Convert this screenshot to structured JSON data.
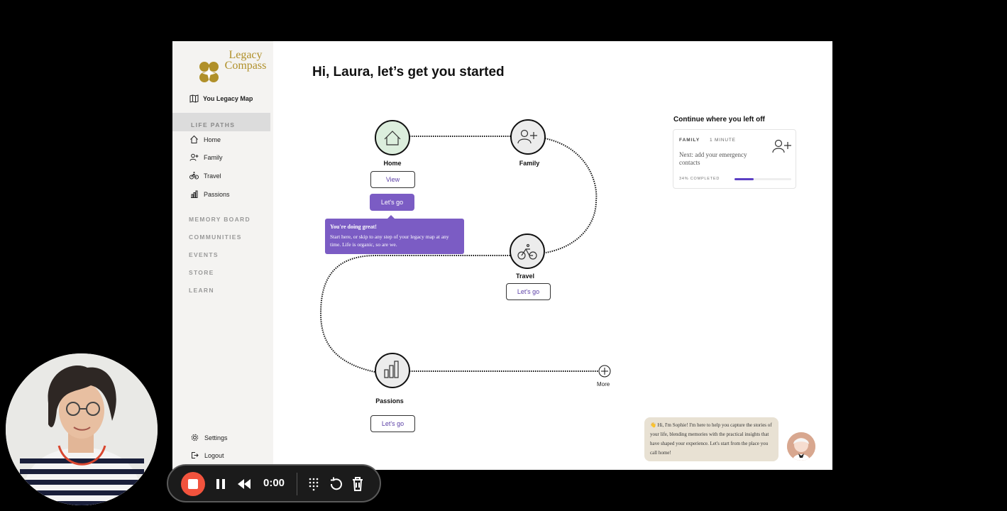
{
  "app": {
    "logo": {
      "line1": "Legacy",
      "line2": "Compass"
    },
    "sidebar": {
      "legacy_map": "You Legacy Map",
      "section": "LIFE PATHS",
      "items": [
        {
          "label": "Home",
          "icon": "home-icon"
        },
        {
          "label": "Family",
          "icon": "add-person-icon"
        },
        {
          "label": "Travel",
          "icon": "bicycle-icon"
        },
        {
          "label": "Passions",
          "icon": "bar-chart-icon"
        }
      ],
      "links": [
        "MEMORY BOARD",
        "COMMUNITIES",
        "EVENTS",
        "STORE",
        "LEARN"
      ],
      "settings": "Settings",
      "logout": "Logout"
    },
    "heading": "Hi, Laura, let’s get you started",
    "map": {
      "home": {
        "label": "Home",
        "view": "View",
        "go": "Let's go"
      },
      "family": {
        "label": "Family"
      },
      "travel": {
        "label": "Travel",
        "go": "Let's go"
      },
      "passions": {
        "label": "Passions",
        "go": "Let's go"
      },
      "more": "More"
    },
    "tooltip": {
      "title": "You're doing great!",
      "body": "Start here, or skip to any step of your legacy map at any time. Life is organic, so are we."
    },
    "continue": {
      "title": "Continue where you left off",
      "category": "FAMILY",
      "duration": "1 MINUTE",
      "next": "Next: add your emergency contacts",
      "progress_label": "34% COMPLETED",
      "progress": 0.34
    },
    "chat": {
      "emoji": "👋",
      "text": "Hi, I'm Sophie! I'm here to help you capture the stories of your life, blending memories with the practical insights that have shaped your experience. Let's start from the place you call home!"
    }
  },
  "recorder": {
    "time": "0:00"
  },
  "colors": {
    "accent": "#7b5cc4",
    "brand_gold": "#b0902a",
    "node_green": "#dceedd",
    "record_red": "#f2533d"
  }
}
